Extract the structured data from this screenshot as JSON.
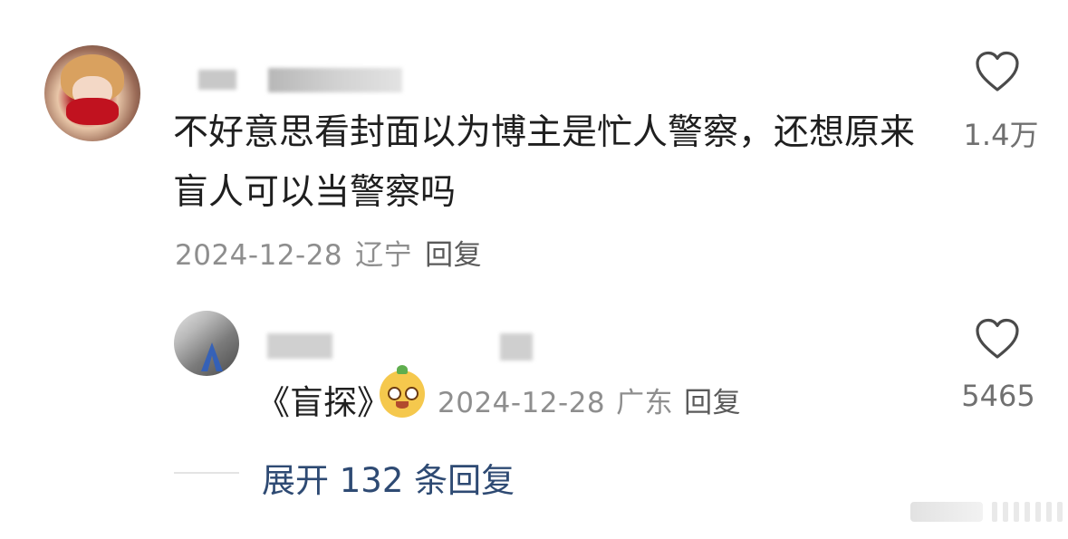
{
  "comment": {
    "text": "不好意思看封面以为博主是忙人警察，还想原来盲人可以当警察吗",
    "date": "2024-12-28",
    "location": "辽宁",
    "reply_label": "回复",
    "likes": "1.4万"
  },
  "reply": {
    "text": "《盲探》",
    "emoji": "puppy-emoji",
    "date": "2024-12-28",
    "location": "广东",
    "reply_label": "回复",
    "likes": "5465"
  },
  "expand": {
    "label": "展开 132 条回复"
  },
  "colors": {
    "text": "#1f1f1f",
    "meta": "#8e8e8e",
    "likes": "#707070",
    "expand": "#2e4a73"
  }
}
